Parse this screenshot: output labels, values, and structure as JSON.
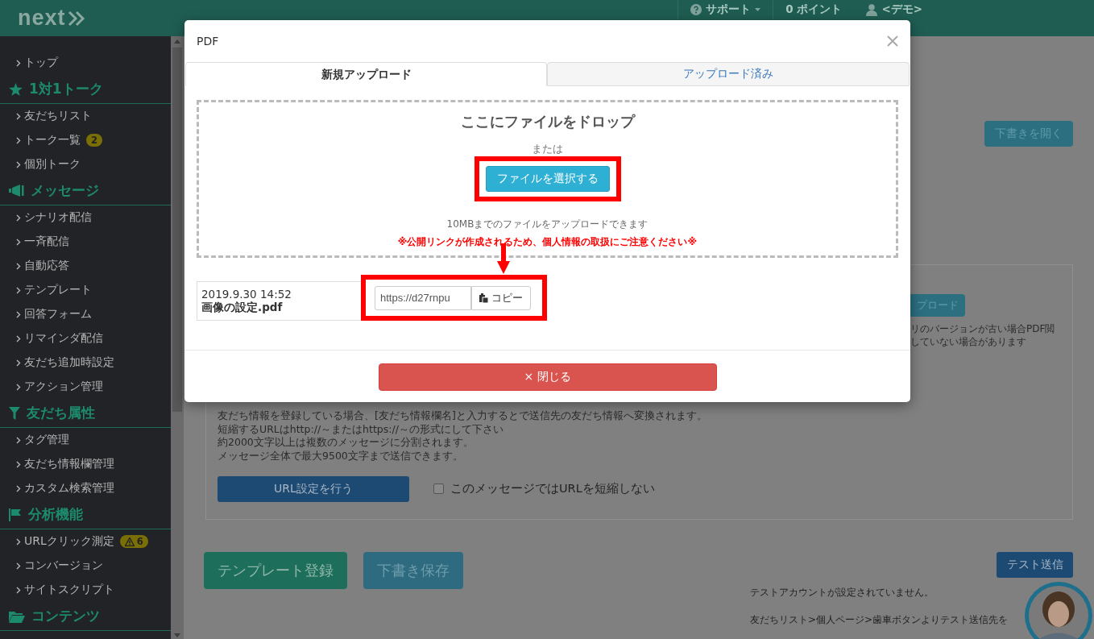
{
  "header": {
    "logo": "next",
    "menu": [
      {
        "kind": "support",
        "label": "サポート"
      },
      {
        "kind": "points",
        "label": "0 ポイント"
      },
      {
        "kind": "user",
        "label": "<デモ>"
      }
    ]
  },
  "sidebar": {
    "top": [
      {
        "label": "トップ"
      }
    ],
    "sections": [
      {
        "label": "1対1トーク",
        "items": [
          {
            "label": "友だちリスト"
          },
          {
            "label": "トーク一覧",
            "badge": {
              "kind": "count",
              "text": "2"
            }
          },
          {
            "label": "個別トーク"
          }
        ]
      },
      {
        "label": "メッセージ",
        "items": [
          {
            "label": "シナリオ配信"
          },
          {
            "label": "一斉配信"
          },
          {
            "label": "自動応答"
          },
          {
            "label": "テンプレート"
          },
          {
            "label": "回答フォーム"
          },
          {
            "label": "リマインダ配信"
          },
          {
            "label": "友だち追加時設定"
          },
          {
            "label": "アクション管理"
          }
        ]
      },
      {
        "label": "友だち属性",
        "items": [
          {
            "label": "タグ管理"
          },
          {
            "label": "友だち情報欄管理"
          },
          {
            "label": "カスタム検索管理"
          }
        ]
      },
      {
        "label": "分析機能",
        "items": [
          {
            "label": "URLクリック測定",
            "badge": {
              "kind": "warning",
              "text": "6"
            }
          },
          {
            "label": "コンバージョン"
          },
          {
            "label": "サイトスクリプト"
          }
        ]
      },
      {
        "label": "コンテンツ"
      }
    ]
  },
  "page": {
    "open_draft_button": "下書きを開く",
    "upload_button": "プロード",
    "notes": [
      "リのバージョンが古い場合PDF閲",
      "していない場合があります"
    ],
    "help_lines": [
      "友だち情報を登録している場合、[友だち情報欄名]と入力するとで送信先の友だち情報へ変換されます。",
      "短縮するURLはhttp://～またはhttps://～の形式にして下さい",
      "約2000文字以上は複数のメッセージに分割されます。",
      "メッセージ全体で最大9500文字まで送信できます。"
    ],
    "url_button": "URL設定を行う",
    "no_shorten": {
      "label": "このメッセージではURLを短縮しない",
      "checked": false
    },
    "template_button": "テンプレート登録",
    "save_draft_button": "下書き保存",
    "test_send_button": "テスト送信",
    "test_notes": [
      "テストアカウントが設定されていません。",
      "友だちリスト>個人ページ>歯車ボタンよりテスト送信先を"
    ]
  },
  "modal": {
    "title": "PDF",
    "tabs": [
      {
        "label": "新規アップロード",
        "selected": true
      },
      {
        "label": "アップロード済み",
        "selected": false
      }
    ],
    "dropzone": {
      "title": "ここにファイルをドロップ",
      "or": "または",
      "button": "ファイルを選択する",
      "limit": "10MBまでのファイルをアップロードできます",
      "warning": "※公開リンクが作成されるため、個人情報の取扱にご注意ください※"
    },
    "files": [
      {
        "date": "2019.9.30 14:52",
        "name": "画像の設定.pdf",
        "url": "https://d27rnpu",
        "copy": "コピー"
      }
    ],
    "close_button": "× 閉じる"
  }
}
